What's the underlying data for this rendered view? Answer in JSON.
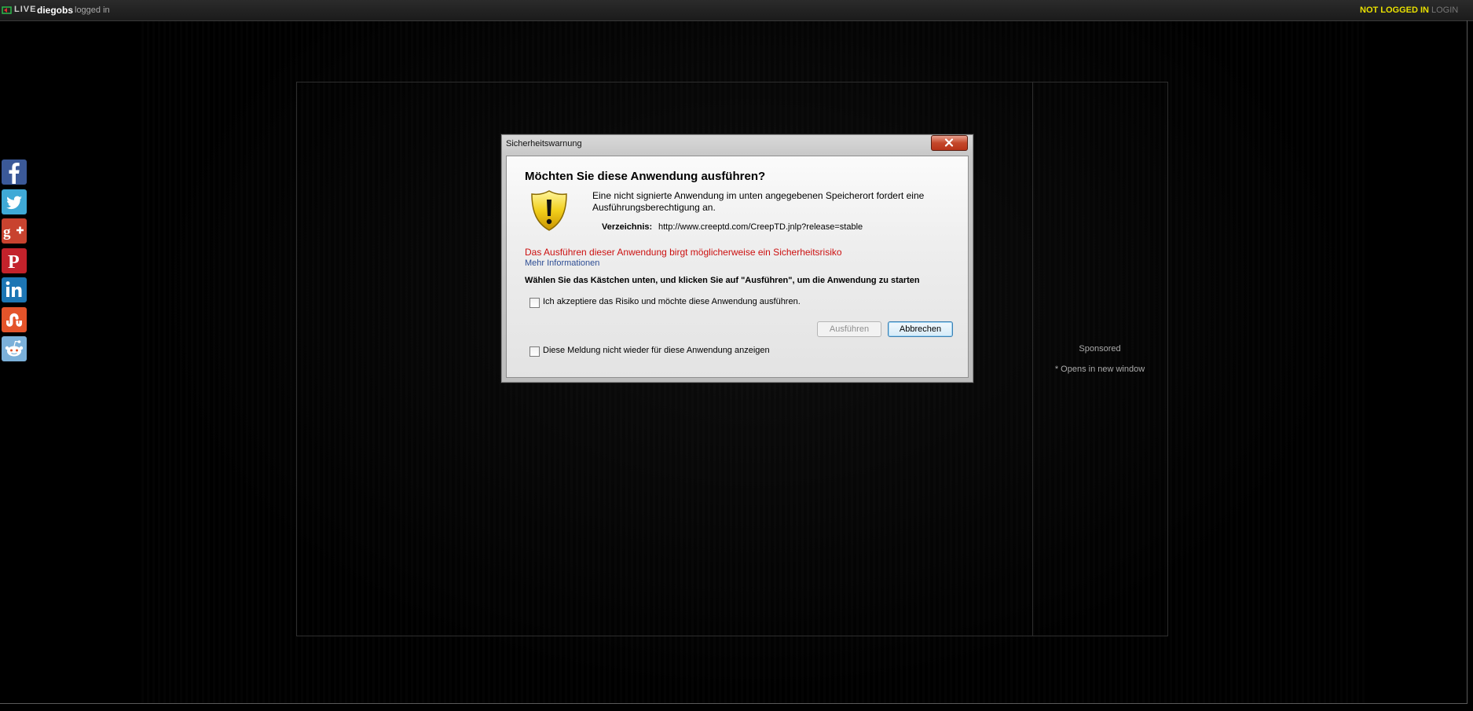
{
  "topbar": {
    "logo_text": "LIVE",
    "username": "diegobs",
    "logged_in_text": "logged in",
    "status_text": "NOT LOGGED IN",
    "login_label": "LOGIN"
  },
  "social": {
    "items": [
      {
        "icon": "facebook-icon",
        "color": "#3b5998"
      },
      {
        "icon": "twitter-icon",
        "color": "#3fa9d6"
      },
      {
        "icon": "google-plus-icon",
        "color": "#c8432f"
      },
      {
        "icon": "pinterest-icon",
        "color": "#c3222b"
      },
      {
        "icon": "linkedin-icon",
        "color": "#1d76b4"
      },
      {
        "icon": "stumbleupon-icon",
        "color": "#e4542a"
      },
      {
        "icon": "reddit-icon",
        "color": "#7bb0d9"
      }
    ]
  },
  "sidebar_ad": {
    "sponsored_label": "Sponsored",
    "opens_note": "* Opens in new window"
  },
  "dialog": {
    "title": "Sicherheitswarnung",
    "heading": "Möchten Sie diese Anwendung ausführen?",
    "description": "Eine nicht signierte Anwendung im unten angegebenen Speicherort fordert eine Ausführungsberechtigung an.",
    "directory_label": "Verzeichnis:",
    "directory_value": "http://www.creeptd.com/CreepTD.jnlp?release=stable",
    "risk_text": "Das Ausführen dieser Anwendung birgt möglicherweise ein Sicherheitsrisiko",
    "more_info_link": "Mehr Informationen",
    "instruction": "Wählen Sie das Kästchen unten, und klicken Sie auf \"Ausführen\", um die Anwendung zu starten",
    "accept_checkbox_label": "Ich akzeptiere das Risiko und möchte diese Anwendung ausführen.",
    "run_button": "Ausführen",
    "cancel_button": "Abbrechen",
    "dont_show_checkbox_label": "Diese Meldung nicht wieder für diese Anwendung anzeigen",
    "close_icon": "close-icon",
    "warning_icon": "warning-shield-icon"
  }
}
